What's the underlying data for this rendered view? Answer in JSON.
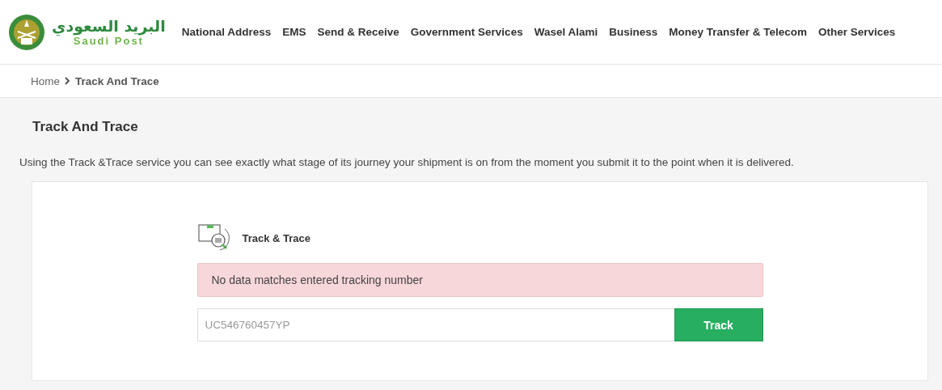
{
  "logo": {
    "arabic": "البريد السعودي",
    "latin": "Saudi Post"
  },
  "nav": [
    "National Address",
    "EMS",
    "Send & Receive",
    "Government Services",
    "Wasel Alami",
    "Business",
    "Money Transfer & Telecom",
    "Other Services"
  ],
  "breadcrumb": [
    {
      "label": "Home",
      "selected": false
    },
    {
      "label": "Track And Trace",
      "selected": true
    }
  ],
  "page_title": "Track And Trace",
  "intro": "Using the Track &Trace service you can see exactly what stage of its journey your shipment is on from the moment you submit it to the point when it is delivered.",
  "panel": {
    "title": "Track & Trace",
    "alert": "No data matches entered tracking number",
    "tracking_field": {
      "value": "UC546760457YP"
    },
    "button": "Track"
  }
}
